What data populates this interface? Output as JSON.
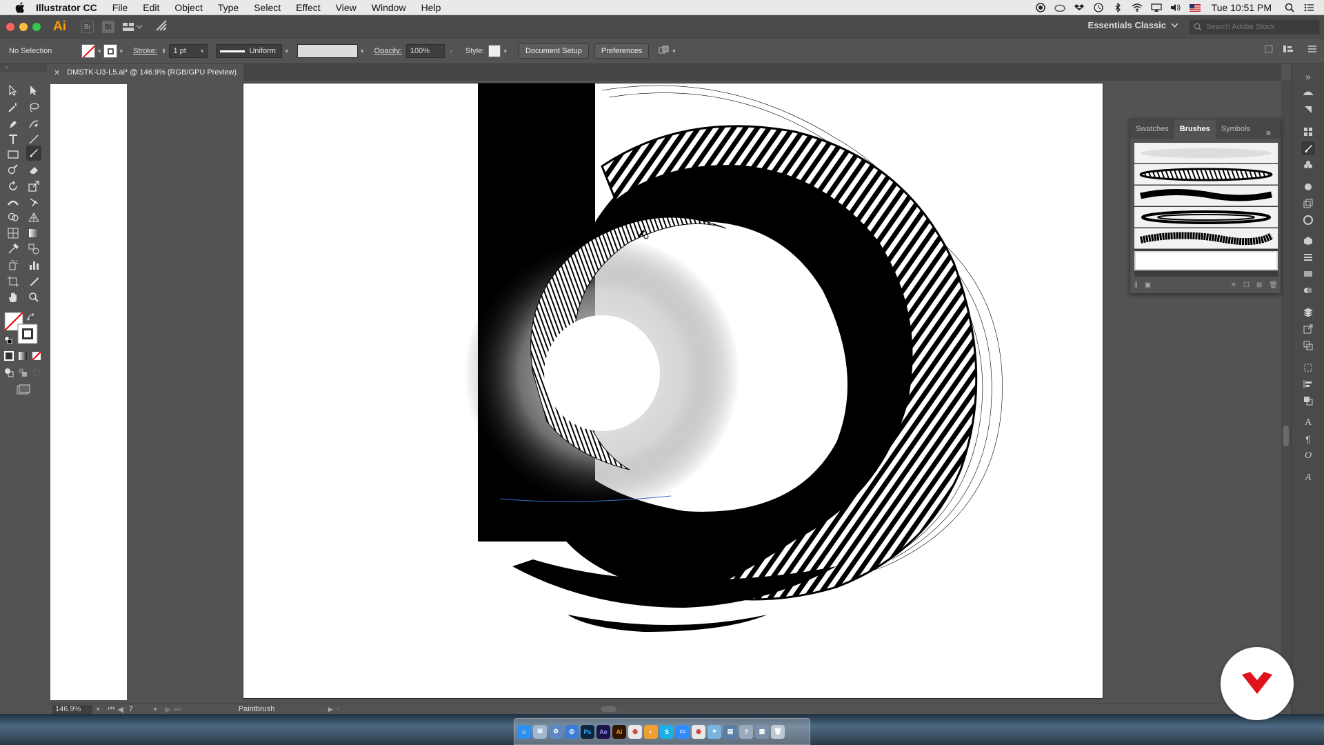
{
  "menubar": {
    "app_name": "Illustrator CC",
    "items": [
      "File",
      "Edit",
      "Object",
      "Type",
      "Select",
      "Effect",
      "View",
      "Window",
      "Help"
    ],
    "clock": "Tue 10:51 PM"
  },
  "appbar": {
    "logo": "Ai",
    "bridge_label": "Br",
    "stock_label": "St",
    "workspace": "Essentials Classic",
    "search_placeholder": "Search Adobe Stock"
  },
  "control": {
    "selection": "No Selection",
    "stroke_label": "Stroke:",
    "stroke_weight": "1 pt",
    "profile": "Uniform",
    "opacity_label": "Opacity:",
    "opacity_value": "100%",
    "style_label": "Style:",
    "document_setup": "Document Setup",
    "preferences": "Preferences"
  },
  "document": {
    "tab_title": "DMSTK-U3-L5.ai* @ 146.9% (RGB/GPU Preview)"
  },
  "brush_panel": {
    "tabs": [
      "Swatches",
      "Brushes",
      "Symbols"
    ],
    "active_tab": "Brushes"
  },
  "status": {
    "zoom": "146.9%",
    "artboard": "7",
    "tool": "Paintbrush"
  },
  "colors": {
    "ui_dark": "#535353",
    "accent_orange": "#ff9a00",
    "badge_red": "#e0131c"
  }
}
